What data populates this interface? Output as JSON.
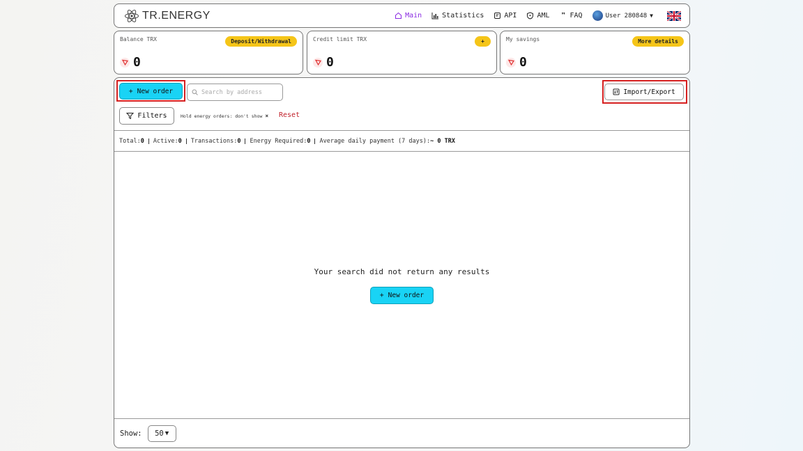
{
  "header": {
    "brand": "TR.ENERGY",
    "nav": [
      {
        "label": "Main",
        "icon": "home-icon",
        "active": true
      },
      {
        "label": "Statistics",
        "icon": "bar-chart-icon"
      },
      {
        "label": "API",
        "icon": "api-icon"
      },
      {
        "label": "AML",
        "icon": "shield-icon"
      },
      {
        "label": "FAQ",
        "icon": "quote-icon"
      }
    ],
    "user": "User 280848",
    "language_flag": "uk-flag-icon"
  },
  "cards": [
    {
      "label": "Balance TRX",
      "button": "Deposit/Withdrawal",
      "value": "0"
    },
    {
      "label": "Credit limit TRX",
      "button": "+",
      "value": "0"
    },
    {
      "label": "My savings",
      "button": "More details",
      "value": "0"
    }
  ],
  "toolbar": {
    "new_order": "New order",
    "search_placeholder": "Search by address",
    "import_export": "Import/Export",
    "filters": "Filters",
    "filter_chip": "Hold energy orders: don't show",
    "reset": "Reset"
  },
  "stats": [
    {
      "label": "Total:",
      "value": "0"
    },
    {
      "label": "Active:",
      "value": "0"
    },
    {
      "label": "Transactions:",
      "value": "0"
    },
    {
      "label": "Energy Required:",
      "value": "0"
    },
    {
      "label": "Average daily payment (7 days):",
      "value": "~ 0 TRX"
    }
  ],
  "empty": {
    "message": "Your search did not return any results",
    "new_order": "New order"
  },
  "footer": {
    "show_label": "Show:",
    "show_value": "50"
  },
  "colors": {
    "accent_cyan": "#19d3f5",
    "accent_yellow": "#f5c518",
    "active_nav": "#8a2be2",
    "reset_red": "#c0202a",
    "highlight_red": "#d62020"
  }
}
